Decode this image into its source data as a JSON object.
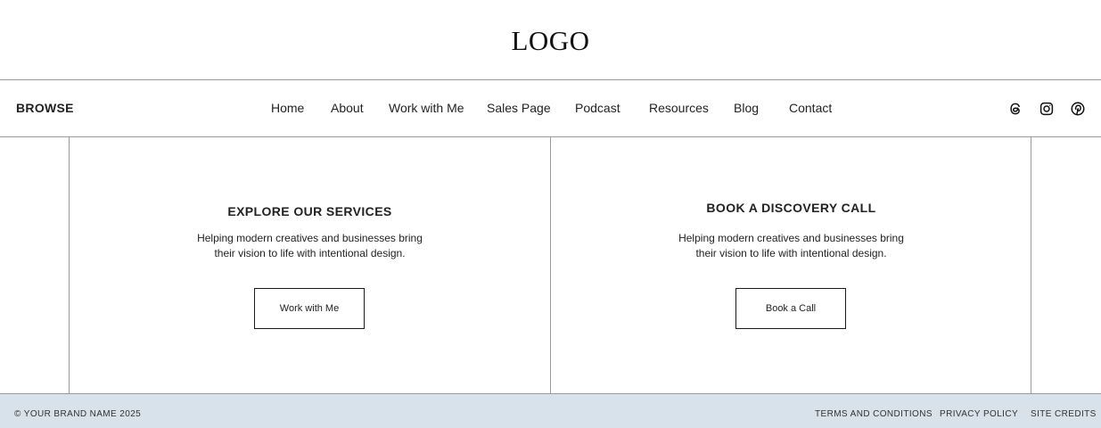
{
  "header": {
    "logo": "LOGO"
  },
  "nav": {
    "browse_label": "BROWSE",
    "links": [
      "Home",
      "About",
      "Work with Me",
      "Sales Page",
      "Podcast",
      "Resources",
      "Blog",
      "Contact"
    ],
    "social_icons": [
      "threads-icon",
      "instagram-icon",
      "pinterest-icon"
    ]
  },
  "panels": [
    {
      "title": "EXPLORE OUR SERVICES",
      "description_line1": "Helping modern creatives and businesses bring",
      "description_line2": "their vision to life with intentional design.",
      "button_label": "Work with Me"
    },
    {
      "title": "BOOK A DISCOVERY CALL",
      "description_line1": "Helping modern creatives and businesses bring",
      "description_line2": "their vision to life with intentional design.",
      "button_label": "Book a Call"
    }
  ],
  "footer": {
    "copyright": "© YOUR BRAND NAME 2025",
    "links": [
      "TERMS AND CONDITIONS",
      "PRIVACY POLICY",
      "SITE CREDITS"
    ],
    "background_color": "#d8e2ea"
  }
}
